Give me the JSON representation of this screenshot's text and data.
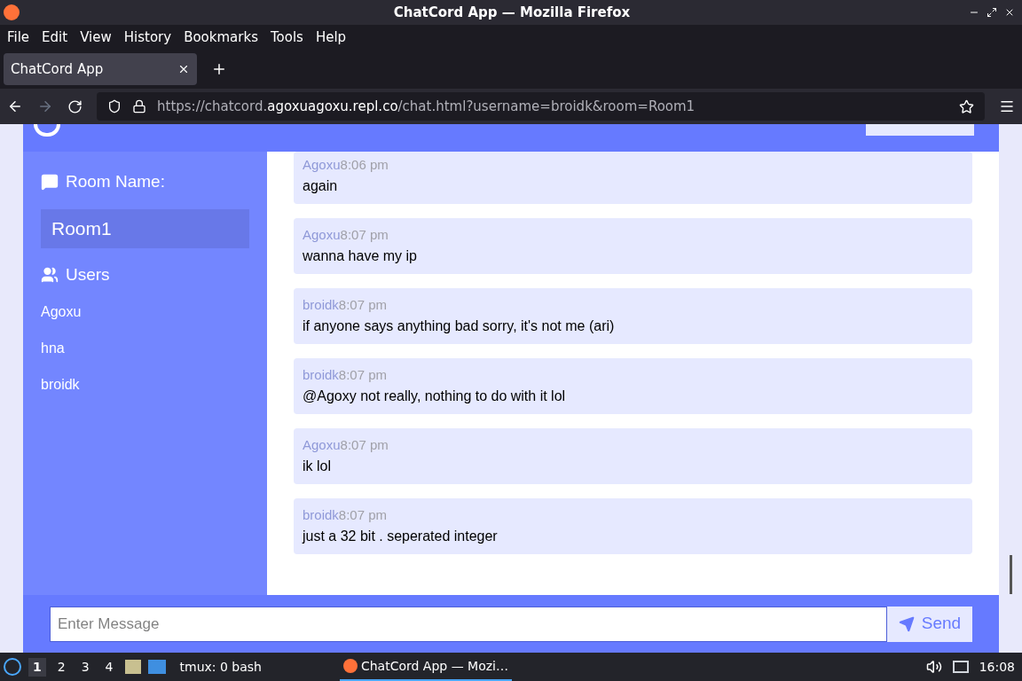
{
  "window": {
    "title": "ChatCord App — Mozilla Firefox"
  },
  "menu": [
    "File",
    "Edit",
    "View",
    "History",
    "Bookmarks",
    "Tools",
    "Help"
  ],
  "tabs": [
    {
      "label": "ChatCord App",
      "selected": true
    }
  ],
  "url": {
    "prefix": "https://chatcord.",
    "domain": "agoxuagoxu.repl.co",
    "path": "/chat.html?username=broidk&room=Room1"
  },
  "sidebar": {
    "room_heading": "Room Name:",
    "room": "Room1",
    "users_heading": "Users",
    "users": [
      "Agoxu",
      "hna",
      "broidk"
    ]
  },
  "messages": [
    {
      "user": "Agoxu",
      "time": "8:06 pm",
      "text": "again"
    },
    {
      "user": "Agoxu",
      "time": "8:07 pm",
      "text": "wanna have my ip"
    },
    {
      "user": "broidk",
      "time": "8:07 pm",
      "text": "if anyone says anything bad sorry, it's not me (ari)"
    },
    {
      "user": "broidk",
      "time": "8:07 pm",
      "text": "@Agoxy not really, nothing to do with it lol"
    },
    {
      "user": "Agoxu",
      "time": "8:07 pm",
      "text": "ik lol"
    },
    {
      "user": "broidk",
      "time": "8:07 pm",
      "text": "just a 32 bit . seperated integer"
    }
  ],
  "composer": {
    "placeholder": "Enter Message",
    "button": "Send"
  },
  "taskbar": {
    "workspaces": [
      {
        "label": "1",
        "selected": true
      },
      {
        "label": "2",
        "selected": false
      },
      {
        "label": "3",
        "selected": false
      },
      {
        "label": "4",
        "selected": false
      }
    ],
    "terminal": "tmux: 0 bash",
    "window": "ChatCord App — Mozi…",
    "clock": "16:08"
  }
}
